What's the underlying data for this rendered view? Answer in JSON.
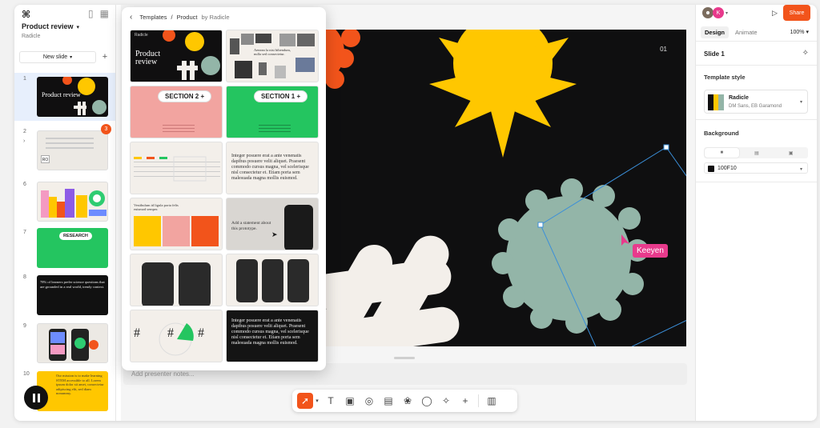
{
  "app": {
    "logo_glyph": "⌘"
  },
  "left": {
    "project_title": "Product review",
    "team": "Radicle",
    "new_slide": "New slide",
    "slides": [
      {
        "num": "1"
      },
      {
        "num": "2",
        "badge": "3",
        "label": "RO"
      },
      {
        "num": "6"
      },
      {
        "num": "7",
        "label": "RESEARCH"
      },
      {
        "num": "8",
        "text": "78% of learners prefer science questions that are grounded in a real world, trendy context."
      },
      {
        "num": "9"
      },
      {
        "num": "10",
        "text": "Our mission is to make learning STEM accessible to all. Lorem ipsum dolor sit amet, consectetur adipiscing elit, sed diam nonummy."
      }
    ]
  },
  "popup": {
    "crumb_root": "Templates",
    "crumb_sep": "/",
    "crumb_current": "Product",
    "crumb_by": "by Radicle",
    "t1_brand": "Radicle",
    "t1_title": "Product review",
    "t2_caption": "Aenean la nisi bibendum, nulla sed consectetur.",
    "section2": "SECTION 2",
    "section1": "SECTION 1",
    "body_text": "Integer posuere erat a ante venenatis dapibus posuere velit aliquet. Praesent commodo cursus magna, vel scelerisque nisl consectetur et. Etiam porta sem malesuada magna mollis euismod.",
    "vestibulum": "Vestibulum id ligula porta felis euismod semper.",
    "statement": "Add a statement about this prototype.",
    "hash": "#"
  },
  "canvas": {
    "slide_number": "01",
    "cursor_user": "Keeyen",
    "notes_placeholder": "Add presenter notes..."
  },
  "toolbar": {
    "tools": [
      "pointer-icon",
      "text-icon",
      "image-icon",
      "shape-icon",
      "table-icon",
      "stamp-icon",
      "comment-icon",
      "ai-icon",
      "plus-icon",
      "layout-icon"
    ]
  },
  "right": {
    "avatar_k": "K",
    "share": "Share",
    "tab_design": "Design",
    "tab_animate": "Animate",
    "zoom": "100%",
    "slide_title": "Slide 1",
    "template_style_header": "Template style",
    "template_name": "Radicle",
    "template_fonts": "DM Sans, EB Garamond",
    "background_header": "Background",
    "background_hex": "100F10"
  },
  "colors": {
    "accent": "#f2541b",
    "slide_bg": "#100F10",
    "yellow": "#ffc700",
    "sage": "#93b5a8",
    "pink": "#e83a8c",
    "selection": "#3b8fd9"
  }
}
